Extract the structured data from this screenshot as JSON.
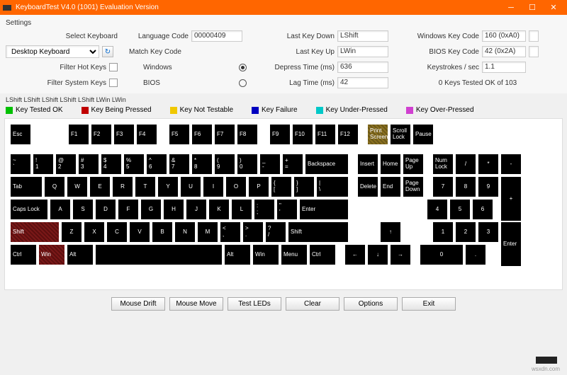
{
  "window": {
    "title": "KeyboardTest V4.0 (1001) Evaluation Version"
  },
  "settings": {
    "label": "Settings",
    "selectKeyboard": "Select Keyboard",
    "keyboardValue": "Desktop Keyboard",
    "filterHotKeys": "Filter Hot Keys",
    "filterSystemKeys": "Filter System Keys"
  },
  "lang": {
    "label": "Language Code",
    "value": "00000409"
  },
  "match": {
    "label": "Match Key Code",
    "windows": "Windows",
    "bios": "BIOS"
  },
  "stats": {
    "lastKeyDown": {
      "lbl": "Last Key Down",
      "val": "LShift"
    },
    "lastKeyUp": {
      "lbl": "Last Key Up",
      "val": "LWin"
    },
    "depress": {
      "lbl": "Depress Time (ms)",
      "val": "636"
    },
    "lag": {
      "lbl": "Lag Time (ms)",
      "val": "42"
    }
  },
  "right": {
    "winCode": {
      "lbl": "Windows Key Code",
      "val": "160 (0xA0)"
    },
    "biosCode": {
      "lbl": "BIOS Key Code",
      "val": "42 (0x2A)"
    },
    "kps": {
      "lbl": "Keystrokes / sec",
      "val": "1.1"
    },
    "tested": "0 Keys Tested OK of 103"
  },
  "sequence": "LShift LShift LShift LShift LShift LWin LWin",
  "legend": {
    "ok": "Key Tested OK",
    "pressed": "Key Being Pressed",
    "nottest": "Key Not Testable",
    "fail": "Key Failure",
    "under": "Key Under-Pressed",
    "over": "Key Over-Pressed"
  },
  "colors": {
    "ok": "#00c000",
    "pressed": "#c00000",
    "nottest": "#f0c800",
    "fail": "#0000c0",
    "under": "#00c8c8",
    "over": "#d040d0"
  },
  "keys": {
    "esc": "Esc",
    "f1": "F1",
    "f2": "F2",
    "f3": "F3",
    "f4": "F4",
    "f5": "F5",
    "f6": "F6",
    "f7": "F7",
    "f8": "F8",
    "f9": "F9",
    "f10": "F10",
    "f11": "F11",
    "f12": "F12",
    "print": "Print Screen",
    "scroll": "Scroll Lock",
    "pause": "Pause",
    "tilde1": "~",
    "tilde2": "`",
    "n1a": "!",
    "n1b": "1",
    "n2a": "@",
    "n2b": "2",
    "n3a": "#",
    "n3b": "3",
    "n4a": "$",
    "n4b": "4",
    "n5a": "%",
    "n5b": "5",
    "n6a": "^",
    "n6b": "6",
    "n7a": "&",
    "n7b": "7",
    "n8a": "*",
    "n8b": "8",
    "n9a": "(",
    "n9b": "9",
    "n0a": ")",
    "n0b": "0",
    "mina": "_",
    "minb": "-",
    "eqa": "+",
    "eqb": "=",
    "bksp": "Backspace",
    "ins": "Insert",
    "home": "Home",
    "pgup": "Page Up",
    "del": "Delete",
    "end": "End",
    "pgdn": "Page Down",
    "numlk": "Num Lock",
    "npdiv": "/",
    "npmul": "*",
    "npsub": "-",
    "npadd": "+",
    "npent": "Enter",
    "np0": "0",
    "np1": "1",
    "np2": "2",
    "np3": "3",
    "np4": "4",
    "np5": "5",
    "np6": "6",
    "np7": "7",
    "np8": "8",
    "np9": "9",
    "npdot": ".",
    "tab": "Tab",
    "q": "Q",
    "w": "W",
    "e": "E",
    "r": "R",
    "t": "T",
    "y": "Y",
    "u": "U",
    "i": "I",
    "o": "O",
    "p": "P",
    "lbra": "{",
    "lbrb": "[",
    "rbra": "}",
    "rbrb": "]",
    "bsla": "|",
    "bslb": "\\",
    "caps": "Caps Lock",
    "a": "A",
    "s": "S",
    "d": "D",
    "f": "F",
    "g": "G",
    "h": "H",
    "j": "J",
    "k": "K",
    "l": "L",
    "sca": ":",
    "scb": ";",
    "qa": "\"",
    "qb": "'",
    "enter": "Enter",
    "lshift": "Shift",
    "z": "Z",
    "x": "X",
    "c": "C",
    "v": "V",
    "b": "B",
    "n": "N",
    "m": "M",
    "cma": "<",
    "cmb": ",",
    "pda": ">",
    "pdb": ".",
    "sla": "?",
    "slb": "/",
    "rshift": "Shift",
    "lctrl": "Ctrl",
    "lwin": "Win",
    "lalt": "Alt",
    "ralt": "Alt",
    "rwin": "Win",
    "menu": "Menu",
    "rctrl": "Ctrl",
    "up": "↑",
    "down": "↓",
    "left": "←",
    "right": "→"
  },
  "buttons": {
    "mouseDrift": "Mouse Drift",
    "mouseMove": "Mouse Move",
    "testLeds": "Test LEDs",
    "clear": "Clear",
    "options": "Options",
    "exit": "Exit"
  },
  "brand": "wsxdn.com"
}
